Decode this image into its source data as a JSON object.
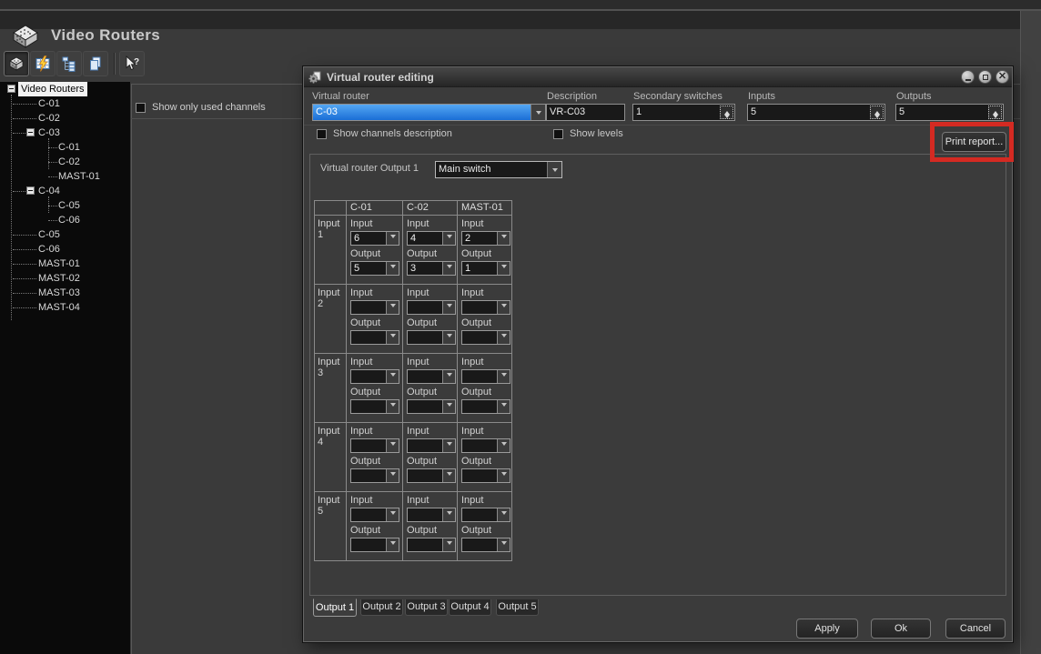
{
  "app": {
    "title": "Video Routers",
    "toolbar": {
      "buttons": [
        {
          "id": "video-routers-view",
          "icon": "router-box-icon",
          "pressed": true
        },
        {
          "id": "matrix-edit",
          "icon": "grid-lightning-icon",
          "pressed": false
        },
        {
          "id": "tree-view",
          "icon": "tree-view-icon",
          "pressed": false
        },
        {
          "id": "copy",
          "icon": "copy-icon",
          "pressed": false
        },
        {
          "id": "context-help",
          "icon": "help-pointer-icon",
          "pressed": false
        }
      ]
    }
  },
  "sidebar": {
    "root": {
      "label": "Video Routers",
      "selected": true
    },
    "items": [
      {
        "label": "C-01",
        "level": 1
      },
      {
        "label": "C-02",
        "level": 1
      },
      {
        "label": "C-03",
        "level": 1,
        "expandable": true
      },
      {
        "label": "C-01",
        "level": 2
      },
      {
        "label": "C-02",
        "level": 2
      },
      {
        "label": "MAST-01",
        "level": 2
      },
      {
        "label": "C-04",
        "level": 1,
        "expandable": true
      },
      {
        "label": "C-05",
        "level": 2
      },
      {
        "label": "C-06",
        "level": 2
      },
      {
        "label": "C-05",
        "level": 1
      },
      {
        "label": "C-06",
        "level": 1
      },
      {
        "label": "MAST-01",
        "level": 1
      },
      {
        "label": "MAST-02",
        "level": 1
      },
      {
        "label": "MAST-03",
        "level": 1
      },
      {
        "label": "MAST-04",
        "level": 1
      }
    ]
  },
  "main": {
    "show_only_used_channels_label": "Show only used channels",
    "show_only_used_channels_checked": false
  },
  "dialog": {
    "title": "Virtual router editing",
    "fields": {
      "virtual_router": {
        "label": "Virtual router",
        "value": "C-03"
      },
      "description": {
        "label": "Description",
        "value": "VR-C03"
      },
      "secondary_switches": {
        "label": "Secondary switches",
        "value": "1"
      },
      "inputs": {
        "label": "Inputs",
        "value": "5"
      },
      "outputs": {
        "label": "Outputs",
        "value": "5"
      }
    },
    "checkboxes": {
      "show_channels_description": {
        "label": "Show channels description",
        "checked": false
      },
      "show_levels": {
        "label": "Show levels",
        "checked": false
      }
    },
    "print_report_button": "Print report...",
    "output_page": {
      "label": "Virtual router Output 1",
      "switch_selector": "Main switch"
    },
    "grid": {
      "input_label": "Input",
      "output_label": "Output",
      "columns": [
        "C-01",
        "C-02",
        "MAST-01"
      ],
      "rows": [
        {
          "label": "Input 1",
          "cells": [
            {
              "input": "6",
              "output": "5"
            },
            {
              "input": "4",
              "output": "3"
            },
            {
              "input": "2",
              "output": "1"
            }
          ]
        },
        {
          "label": "Input 2",
          "cells": [
            {
              "input": "",
              "output": ""
            },
            {
              "input": "",
              "output": ""
            },
            {
              "input": "",
              "output": ""
            }
          ]
        },
        {
          "label": "Input 3",
          "cells": [
            {
              "input": "",
              "output": ""
            },
            {
              "input": "",
              "output": ""
            },
            {
              "input": "",
              "output": ""
            }
          ]
        },
        {
          "label": "Input 4",
          "cells": [
            {
              "input": "",
              "output": ""
            },
            {
              "input": "",
              "output": ""
            },
            {
              "input": "",
              "output": ""
            }
          ]
        },
        {
          "label": "Input 5",
          "cells": [
            {
              "input": "",
              "output": ""
            },
            {
              "input": "",
              "output": ""
            },
            {
              "input": "",
              "output": ""
            }
          ]
        }
      ]
    },
    "tabs": [
      {
        "label": "Output 1",
        "active": true
      },
      {
        "label": "Output 2",
        "active": false
      },
      {
        "label": "Output 3",
        "active": false
      },
      {
        "label": "Output 4",
        "active": false
      },
      {
        "label": "Output 5",
        "active": false
      }
    ],
    "buttons": {
      "apply": "Apply",
      "ok": "Ok",
      "cancel": "Cancel"
    }
  },
  "annotation": {
    "highlight_color": "#d42a22",
    "highlighted_control": "Print report..."
  }
}
